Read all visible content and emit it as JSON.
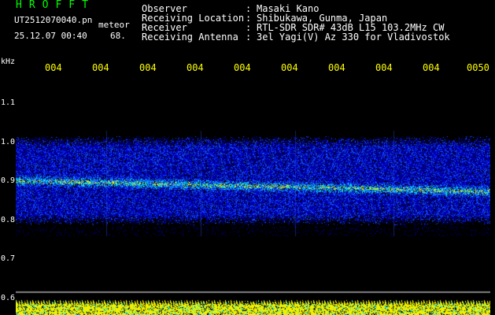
{
  "header": {
    "app_title": "HROFFT",
    "file_name": "UT2512070040.pn",
    "meteor_label": "meteor",
    "timestamp": "25.12.07 00:40",
    "count": "68.",
    "fields": [
      {
        "label": "Observer",
        "value": "Masaki Kano"
      },
      {
        "label": "Receiving Location",
        "value": "Shibukawa, Gunma, Japan"
      },
      {
        "label": "Receiver",
        "value": "RTL-SDR SDR# 43dB L15 103.2MHz CW"
      },
      {
        "label": "Receiving Antenna",
        "value": "3el Yagi(V) Az 330 for Vladivostok"
      }
    ],
    "separator": ":"
  },
  "axes": {
    "unit_label": "kHz",
    "time_ticks": [
      "004",
      "004",
      "004",
      "004",
      "004",
      "004",
      "004",
      "004",
      "004",
      "0050"
    ],
    "freq_ticks": [
      "1.1",
      "1.0",
      "0.9",
      "0.8",
      "0.7",
      "0.6"
    ]
  },
  "colors": {
    "background": "#000000",
    "title": "#00ff00",
    "time_ticks": "#ffff00",
    "band_low": "#0000ff",
    "band_mid": "#00ffff",
    "band_high": "#ffff00"
  },
  "spectrogram": {
    "freq_range_khz": [
      0.58,
      1.15
    ],
    "band_khz": [
      0.79,
      1.02
    ],
    "carrier_khz": 0.9
  }
}
